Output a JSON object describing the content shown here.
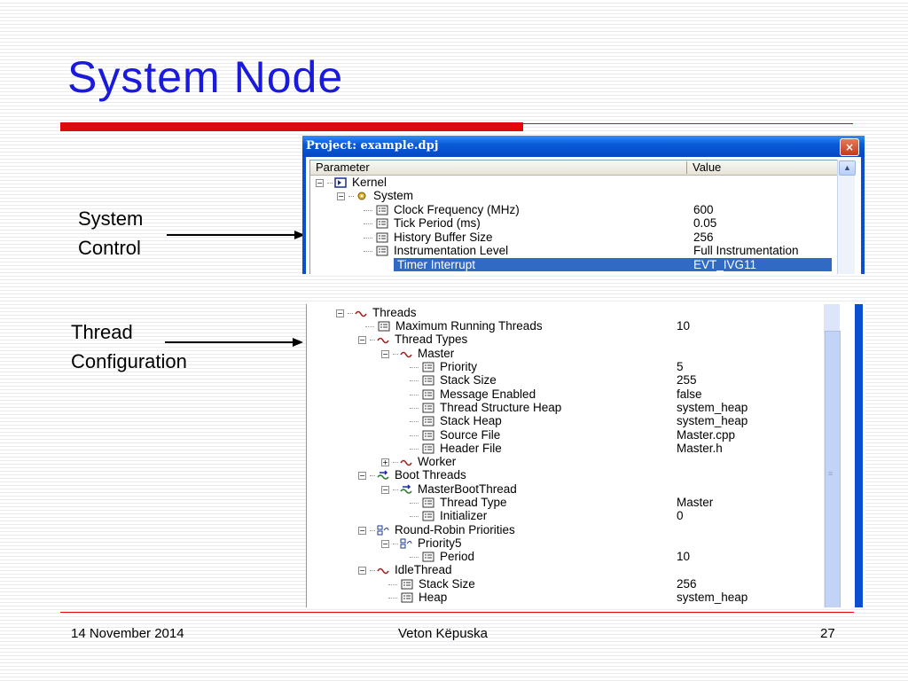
{
  "slide": {
    "title": "System Node",
    "callouts": [
      "System\nControl",
      "Thread\nConfiguration"
    ],
    "footer": {
      "date": "14 November 2014",
      "author": "Veton Këpuska",
      "page": "27"
    }
  },
  "window": {
    "title": "Project: example.dpj",
    "close_label": "×",
    "columns": [
      "Parameter",
      "Value"
    ]
  },
  "tree_top": [
    {
      "label": "Kernel",
      "value": "",
      "icon": "kernel-icon",
      "expander": "⊟"
    },
    {
      "label": "System",
      "value": "",
      "icon": "system-gear-icon",
      "expander": "⊟"
    },
    {
      "label": "Clock Frequency (MHz)",
      "value": "600",
      "icon": "property-icon"
    },
    {
      "label": "Tick Period (ms)",
      "value": "0.05",
      "icon": "property-icon"
    },
    {
      "label": "History Buffer Size",
      "value": "256",
      "icon": "property-icon"
    },
    {
      "label": "Instrumentation Level",
      "value": "Full Instrumentation",
      "icon": "property-icon"
    },
    {
      "label": "Timer Interrupt",
      "value": "EVT_IVG11",
      "icon": "property-icon",
      "selected": true
    }
  ],
  "tree_bottom": [
    {
      "label": "Threads",
      "value": "",
      "icon": "thread-wave-icon",
      "expander": "⊟"
    },
    {
      "label": "Maximum Running Threads",
      "value": "10",
      "icon": "property-icon"
    },
    {
      "label": "Thread Types",
      "value": "",
      "icon": "thread-wave-icon",
      "expander": "⊟"
    },
    {
      "label": "Master",
      "value": "",
      "icon": "thread-wave-icon",
      "expander": "⊟"
    },
    {
      "label": "Priority",
      "value": "5",
      "icon": "property-icon"
    },
    {
      "label": "Stack Size",
      "value": "255",
      "icon": "property-icon"
    },
    {
      "label": "Message Enabled",
      "value": "false",
      "icon": "property-icon"
    },
    {
      "label": "Thread Structure Heap",
      "value": "system_heap",
      "icon": "property-icon"
    },
    {
      "label": "Stack Heap",
      "value": "system_heap",
      "icon": "property-icon"
    },
    {
      "label": "Source File",
      "value": "Master.cpp",
      "icon": "property-icon"
    },
    {
      "label": "Header File",
      "value": "Master.h",
      "icon": "property-icon"
    },
    {
      "label": "Worker",
      "value": "",
      "icon": "thread-wave-icon",
      "expander": "⊞"
    },
    {
      "label": "Boot Threads",
      "value": "",
      "icon": "boot-thread-icon",
      "expander": "⊟"
    },
    {
      "label": "MasterBootThread",
      "value": "",
      "icon": "boot-thread-icon",
      "expander": "⊟"
    },
    {
      "label": "Thread Type",
      "value": "Master",
      "icon": "property-icon"
    },
    {
      "label": "Initializer",
      "value": "0",
      "icon": "property-icon"
    },
    {
      "label": "Round-Robin Priorities",
      "value": "",
      "icon": "round-robin-icon",
      "expander": "⊟"
    },
    {
      "label": "Priority5",
      "value": "",
      "icon": "round-robin-icon",
      "expander": "⊟"
    },
    {
      "label": "Period",
      "value": "10",
      "icon": "property-icon"
    },
    {
      "label": "IdleThread",
      "value": "",
      "icon": "thread-wave-icon",
      "expander": "⊟"
    },
    {
      "label": "Stack Size",
      "value": "256",
      "icon": "property-icon"
    },
    {
      "label": "Heap",
      "value": "system_heap",
      "icon": "property-icon"
    }
  ],
  "colors": {
    "title": "#1a1adc",
    "accent_red": "#dd0b0b",
    "selection": "#316ac5",
    "window_frame": "#0b4fd0"
  }
}
